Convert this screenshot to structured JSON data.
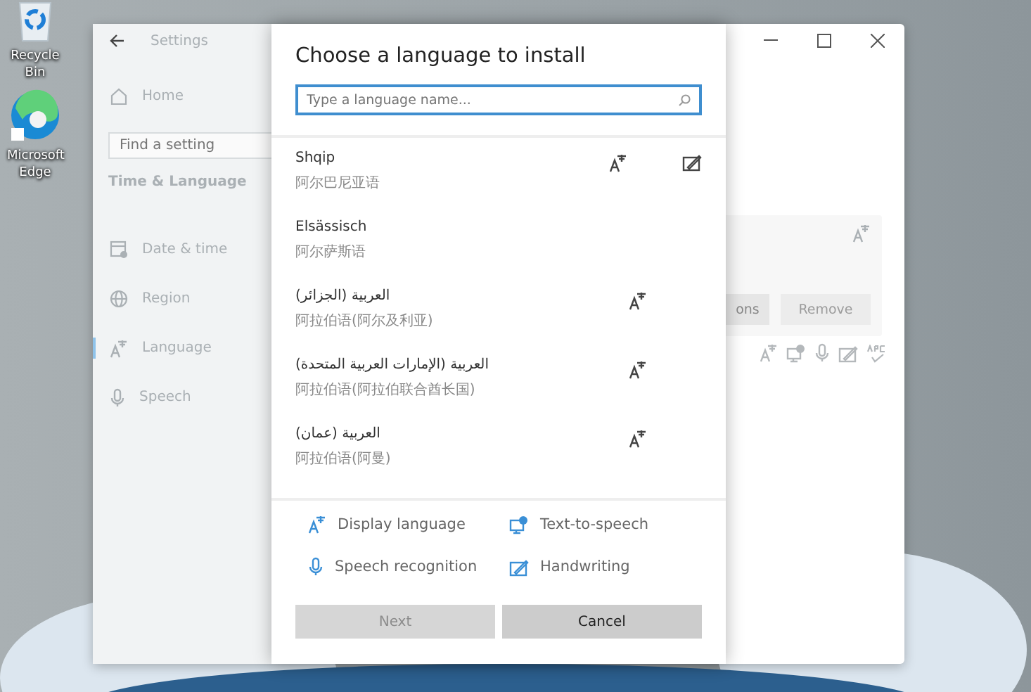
{
  "desktop": {
    "icons": [
      {
        "kind": "recycle",
        "label": "Recycle Bin"
      },
      {
        "kind": "browser",
        "label": "Microsoft Edge"
      }
    ]
  },
  "settings": {
    "title": "Settings",
    "home": "Home",
    "search": {
      "placeholder": "Find a setting"
    },
    "section": "Time & Language",
    "nav": [
      {
        "kind": "clock",
        "label": "Date & time",
        "selected": false
      },
      {
        "kind": "globe",
        "label": "Region",
        "selected": false
      },
      {
        "kind": "language",
        "label": "Language",
        "selected": true
      },
      {
        "kind": "mic",
        "label": "Speech",
        "selected": false
      }
    ],
    "card": {
      "buttons": [
        {
          "label": "ons",
          "disabled": false
        },
        {
          "label": "Remove",
          "disabled": true
        }
      ]
    }
  },
  "dialog": {
    "title": "Choose a language to install",
    "search": {
      "placeholder": "Type a language name..."
    },
    "languages": [
      {
        "name": "Shqip",
        "native": "阿尔巴尼亚语",
        "display": true,
        "handwriting": true
      },
      {
        "name": "Elsässisch",
        "native": "阿尔萨斯语",
        "display": false,
        "handwriting": false
      },
      {
        "name": "العربية (الجزائر)",
        "native": "阿拉伯语(阿尔及利亚)",
        "display": true,
        "handwriting": false
      },
      {
        "name": "العربية (الإمارات العربية المتحدة)",
        "native": "阿拉伯语(阿拉伯联合酋长国)",
        "display": true,
        "handwriting": false
      },
      {
        "name": "العربية (عمان)",
        "native": "阿拉伯语(阿曼)",
        "display": true,
        "handwriting": false
      }
    ],
    "legend": [
      {
        "kind": "display",
        "label": "Display language"
      },
      {
        "kind": "tts",
        "label": "Text-to-speech"
      },
      {
        "kind": "mic",
        "label": "Speech recognition"
      },
      {
        "kind": "handwriting",
        "label": "Handwriting"
      }
    ],
    "buttons": [
      {
        "label": "Next",
        "disabled": true
      },
      {
        "label": "Cancel",
        "disabled": false
      }
    ]
  }
}
